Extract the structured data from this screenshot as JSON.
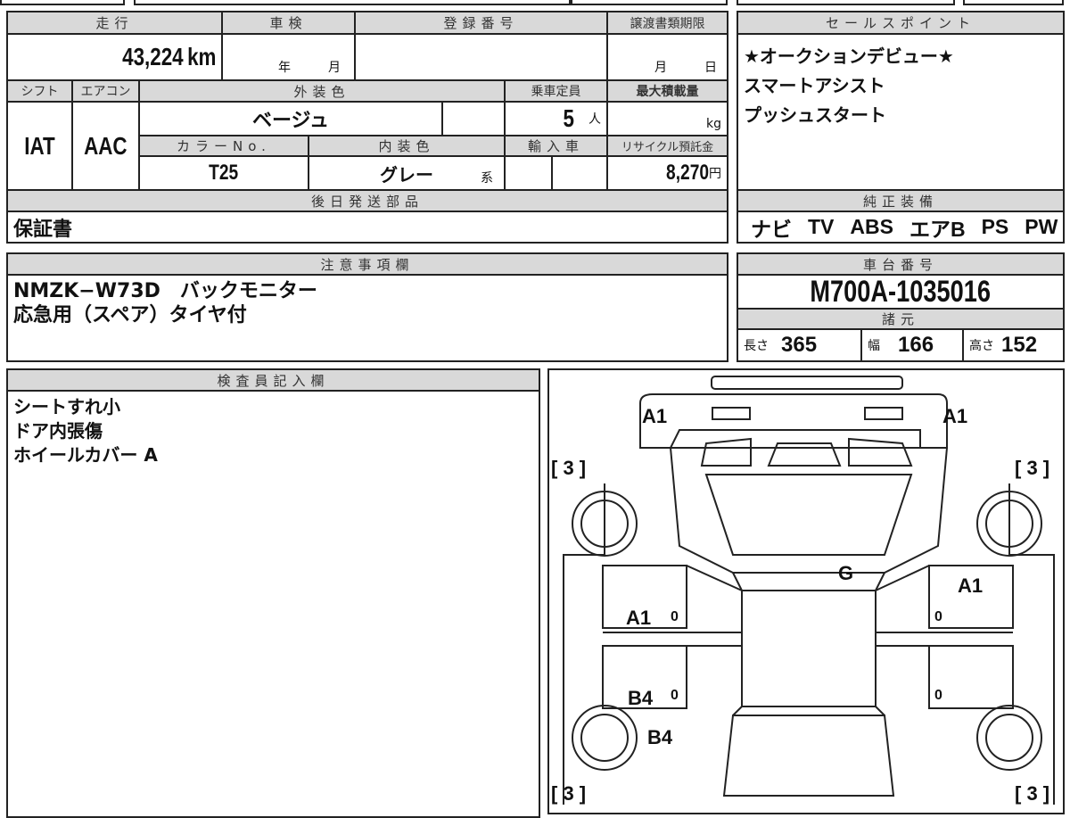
{
  "odometer": {
    "label": "走行",
    "value": "43,224",
    "unit": "km"
  },
  "inspection": {
    "label": "車検",
    "year_unit": "年",
    "month_unit": "月"
  },
  "registration": {
    "label": "登録番号",
    "value": ""
  },
  "transfer": {
    "label": "譲渡書類期限",
    "month_unit": "月",
    "day_unit": "日"
  },
  "shift": {
    "label": "シフト",
    "value": "IAT"
  },
  "aircon": {
    "label": "エアコン",
    "value": "AAC"
  },
  "exterior_color": {
    "label": "外装色",
    "value": "ベージュ"
  },
  "capacity": {
    "label": "乗車定員",
    "value": "5",
    "unit": "人"
  },
  "max_load": {
    "label": "最大積載量",
    "unit": "kg"
  },
  "color_no": {
    "label": "カラーNo.",
    "value": "T25"
  },
  "interior_color": {
    "label": "内装色",
    "value": "グレー",
    "suffix": "系"
  },
  "import": {
    "label": "輸入車"
  },
  "recycle": {
    "label": "リサイクル預託金",
    "value": "8,270",
    "unit": "円"
  },
  "later_parts": {
    "label": "後日発送部品",
    "value": "保証書"
  },
  "sales_points": {
    "label": "セールスポイント",
    "items": [
      "★オークションデビュー★",
      "スマートアシスト",
      "プッシュスタート"
    ]
  },
  "equipment": {
    "label": "純正装備",
    "items": [
      "ナビ",
      "TV",
      "ABS",
      "エアB",
      "PS",
      "PW"
    ]
  },
  "notes": {
    "label": "注意事項欄",
    "lines": [
      "NMZK−W73D　バックモニター",
      "応急用（スペア）タイヤ付"
    ]
  },
  "chassis": {
    "label": "車台番号",
    "value": "M700A-1035016"
  },
  "specs": {
    "label": "諸元",
    "length_label": "長さ",
    "length": "365",
    "width_label": "幅",
    "width": "166",
    "height_label": "高さ",
    "height": "152"
  },
  "inspector": {
    "label": "検査員記入欄",
    "lines": [
      "シートすれ小",
      "ドア内張傷",
      "ホイールカバー A"
    ]
  },
  "diagram": {
    "marks": {
      "fl": "A1",
      "fr": "A1",
      "bracket": "[ 3 ]",
      "roof": "G",
      "r_door": "A1",
      "l_front_door": "A1",
      "l_rear_door": "B4",
      "l_rear": "B4",
      "zero": "0"
    }
  }
}
